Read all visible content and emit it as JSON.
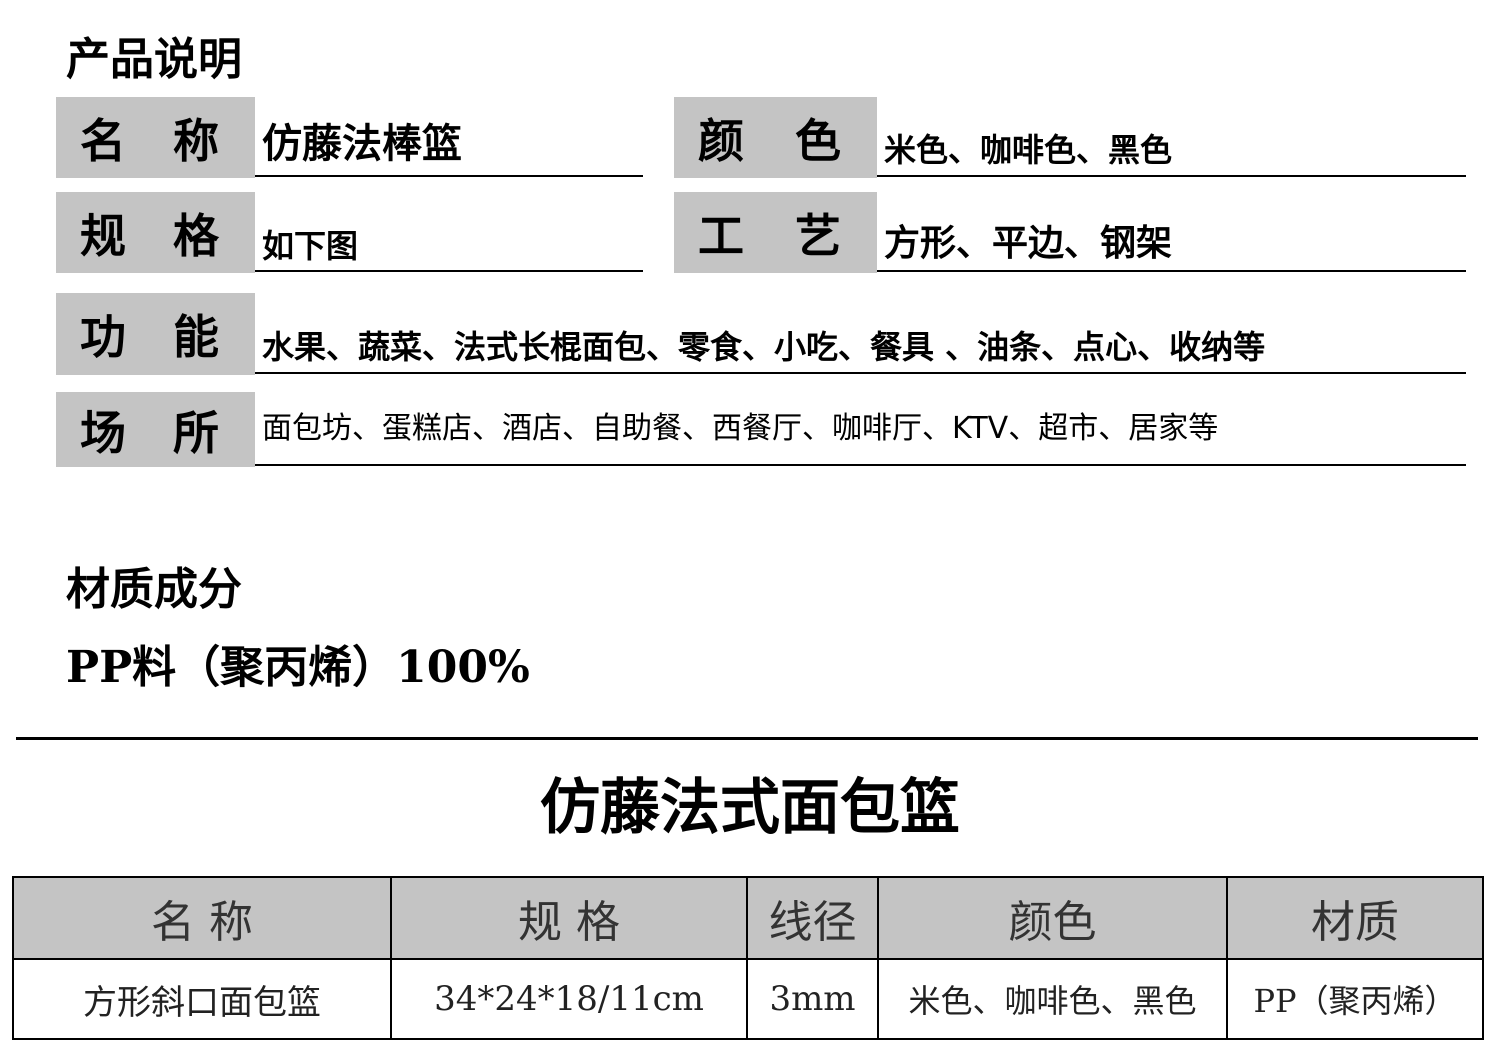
{
  "product_section": {
    "heading": "产品说明",
    "rows": [
      {
        "label_a": "名",
        "label_b": "称",
        "value": "仿藤法棒篮"
      },
      {
        "label_a": "颜",
        "label_b": "色",
        "value": "米色、咖啡色、黑色"
      },
      {
        "label_a": "规",
        "label_b": "格",
        "value": "如下图"
      },
      {
        "label_a": "工",
        "label_b": "艺",
        "value": "方形、平边、钢架"
      },
      {
        "label_a": "功",
        "label_b": "能",
        "value": "水果、蔬菜、法式长棍面包、零食、小吃、餐具 、油条、点心、收纳等"
      },
      {
        "label_a": "场",
        "label_b": "所",
        "value": "面包坊、蛋糕店、酒店、自助餐、西餐厅、咖啡厅、KTV、超市、居家等"
      }
    ]
  },
  "material_section": {
    "heading": "材质成分",
    "value": "PP料（聚丙烯）100%"
  },
  "spec_table": {
    "title": "仿藤法式面包篮",
    "headers": [
      "名 称",
      "规 格",
      "线径",
      "颜色",
      "材质"
    ],
    "rows": [
      [
        "方形斜口面包篮",
        "34*24*18/11cm",
        "3mm",
        "米色、咖啡色、黑色",
        "PP（聚丙烯）"
      ]
    ]
  }
}
